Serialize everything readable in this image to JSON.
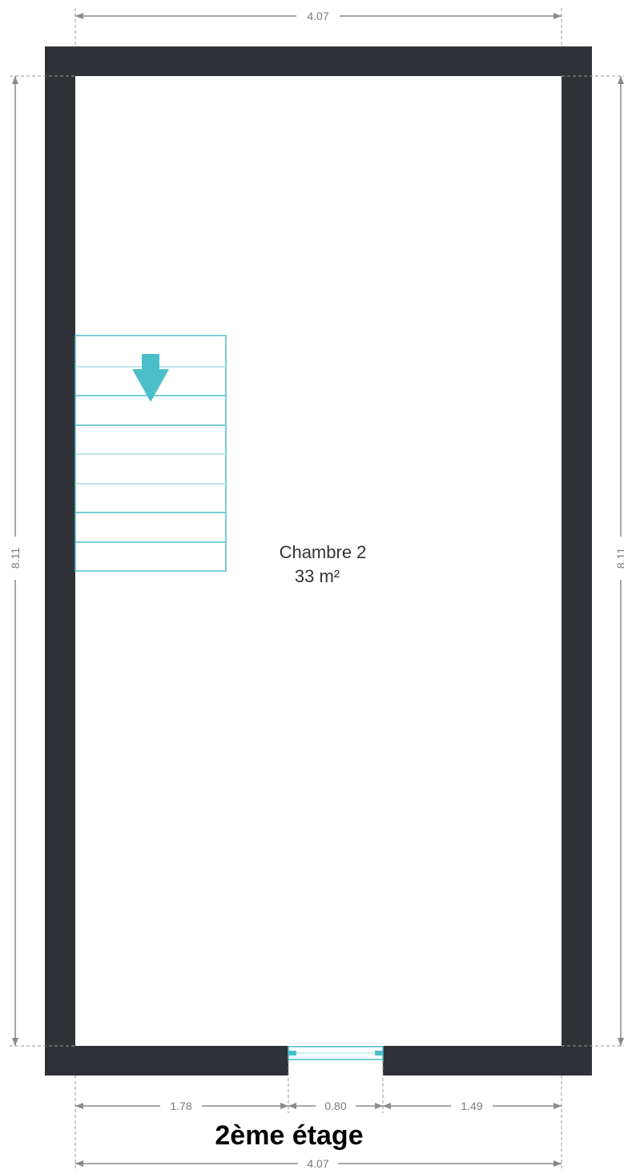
{
  "plan": {
    "floor_title": "2ème étage",
    "room": {
      "name": "Chambre 2",
      "area": "33 m²"
    },
    "dimensions": {
      "top_width": "4.07",
      "bottom_width": "4.07",
      "left_height": "8.11",
      "right_height": "8.11",
      "bottom_left_segment": "1.78",
      "door_width": "0.80",
      "bottom_right_segment": "1.49"
    },
    "colors": {
      "wall": "#2f3236",
      "stair": "#4bbfc9",
      "dimension": "#8a8a8a"
    }
  }
}
